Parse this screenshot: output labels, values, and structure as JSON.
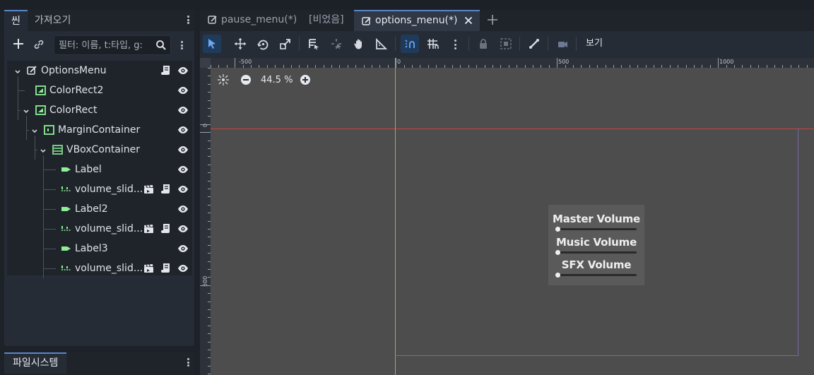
{
  "scene_dock": {
    "tabs": [
      "씬",
      "가져오기"
    ],
    "active_tab": 0,
    "filter_placeholder": "필터: 이름, t:타입, g:"
  },
  "scene_tree": [
    {
      "label": "OptionsMenu",
      "icon": "control-icon",
      "script": true,
      "instance": false,
      "expanded": true
    },
    {
      "label": "ColorRect2",
      "icon": "colorrect-icon",
      "script": false,
      "instance": false
    },
    {
      "label": "ColorRect",
      "icon": "colorrect-icon",
      "script": false,
      "instance": false,
      "expanded": true
    },
    {
      "label": "MarginContainer",
      "icon": "margin-container-icon",
      "script": false,
      "instance": false,
      "expanded": true
    },
    {
      "label": "VBoxContainer",
      "icon": "vbox-container-icon",
      "script": false,
      "instance": false,
      "expanded": true
    },
    {
      "label": "Label",
      "icon": "label-icon",
      "script": false,
      "instance": false
    },
    {
      "label": "volume_slid...",
      "icon": "hslider-icon",
      "script": true,
      "instance": true
    },
    {
      "label": "Label2",
      "icon": "label-icon",
      "script": false,
      "instance": false
    },
    {
      "label": "volume_slid...",
      "icon": "hslider-icon",
      "script": true,
      "instance": true
    },
    {
      "label": "Label3",
      "icon": "label-icon",
      "script": false,
      "instance": false
    },
    {
      "label": "volume_slid...",
      "icon": "hslider-icon",
      "script": true,
      "instance": true
    }
  ],
  "filesystem_dock": {
    "tab": "파일시스템"
  },
  "file_tabs": [
    {
      "label": "pause_menu(*)",
      "icon": true,
      "active": false
    },
    {
      "label": "[비었음]",
      "icon": false,
      "active": false
    },
    {
      "label": "options_menu(*)",
      "icon": true,
      "active": true
    }
  ],
  "toolbar": {
    "view_label": "보기"
  },
  "viewport": {
    "zoom_text": "44.5 %",
    "ruler_top_labels": [
      "-500",
      "0",
      "500",
      "1000"
    ],
    "ruler_left_labels": [
      "0",
      "500"
    ]
  },
  "options_menu": {
    "labels": [
      "Master Volume",
      "Music Volume",
      "SFX Volume"
    ],
    "slider_values": [
      0,
      0,
      0
    ]
  },
  "colors": {
    "accent": "#5a86c7",
    "x_axis": "#c9453f",
    "y_axis": "#8fb35a",
    "node_green": "#8eef97"
  }
}
